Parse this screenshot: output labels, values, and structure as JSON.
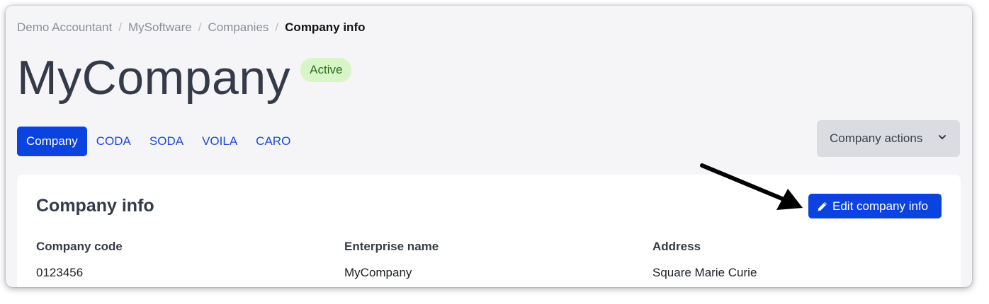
{
  "breadcrumb": {
    "items": [
      "Demo Accountant",
      "MySoftware",
      "Companies"
    ],
    "separator": "/",
    "current": "Company info"
  },
  "header": {
    "title": "MyCompany",
    "status": "Active"
  },
  "tabs": [
    {
      "label": "Company",
      "active": true
    },
    {
      "label": "CODA",
      "active": false
    },
    {
      "label": "SODA",
      "active": false
    },
    {
      "label": "VOILA",
      "active": false
    },
    {
      "label": "CARO",
      "active": false
    }
  ],
  "actions": {
    "label": "Company actions",
    "icon": "chevron-down-icon"
  },
  "card": {
    "title": "Company info",
    "edit_label": "Edit company info",
    "edit_icon": "pencil-icon",
    "fields": [
      {
        "label": "Company code",
        "value": "0123456"
      },
      {
        "label": "Enterprise name",
        "value": "MyCompany"
      },
      {
        "label": "Address",
        "value": "Square Marie Curie"
      }
    ]
  },
  "annotation": {
    "icon": "pointer-arrow-icon"
  },
  "colors": {
    "primary": "#0b43e0",
    "badge_bg": "#d8f5c8",
    "badge_text": "#2d6a1f",
    "background": "#f5f5f8"
  }
}
